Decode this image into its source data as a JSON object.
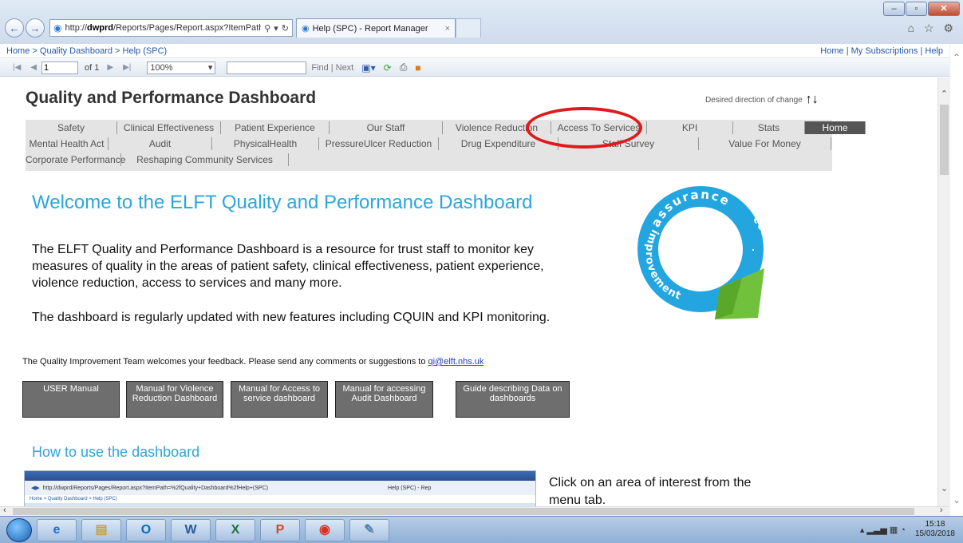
{
  "browser": {
    "url_prefix": "http://",
    "url_host": "dwprd",
    "url_rest": "/Reports/Pages/Report.aspx?ItemPath=%",
    "tab_title": "Help (SPC) - Report Manager",
    "tab_close": "×",
    "window_minimize": "–",
    "window_maximize": "▫",
    "window_close": "✕",
    "icons": "⌂ ☆ ⚙"
  },
  "breadcrumb": {
    "home": "Home",
    "dashboard": "Quality Dashboard",
    "current": "Help (SPC)",
    "separator": " > "
  },
  "toplinks": {
    "home": "Home",
    "subscriptions": "My Subscriptions",
    "help": "Help",
    "separator": " | "
  },
  "toolbar": {
    "page_value": "1",
    "page_of": "of 1",
    "zoom": "100%",
    "find": "Find",
    "next": "Next",
    "find_sep": "|"
  },
  "report": {
    "title": "Quality and Performance Dashboard",
    "direction_label": "Desired direction of change",
    "direction_arrows": "↑↓",
    "menu_row1": [
      "Safety",
      "Clinical Effectiveness",
      "Patient Experience",
      "Our Staff",
      "Violence Reduction",
      "Access To Services",
      "KPI",
      "Stats",
      "Home"
    ],
    "menu_row2": [
      "Mental Health Act",
      "Audit",
      "PhysicalHealth",
      "PressureUlcer Reduction",
      "Drug Expenditure",
      "Staff Survey",
      "Value For Money"
    ],
    "menu_row3": [
      "Corporate Performance",
      "Reshaping Community Services"
    ],
    "welcome": "Welcome to the ELFT Quality and Performance Dashboard",
    "para1_line1": "The ELFT Quality and Performance Dashboard is a resource for trust staff to monitor key",
    "para1_line2": "measures of quality in the areas of patient safety, clinical effectiveness, patient experience,",
    "para1_line3": "violence reduction, access to services and many more.",
    "para2": "The dashboard is regularly updated with new features including CQUIN and KPI monitoring.",
    "feedback_text": "The Quality Improvement Team welcomes your feedback. Please send any comments or suggestions to ",
    "feedback_email": "qi@elft.nhs.uk",
    "buttons": [
      "USER Manual",
      "Manual for Violence Reduction Dashboard",
      "Manual for Access to service dashboard",
      "Manual for accessing Audit Dashboard",
      "Guide describing Data on dashboards"
    ],
    "howto": "How to use the dashboard",
    "click_line1": "Click on an area of interest from the",
    "click_line2": "menu tab.",
    "logo_words": [
      "assurance",
      "control",
      "improvement"
    ],
    "mini_url": "http://dwprd/Reports/Pages/Report.aspx?ItemPath=%2fQuality+Dashboard%2fHelp+(SPC)",
    "mini_tab": "Help (SPC) - Rep",
    "mini_crumb": "Home > Quality Dashboard > Help (SPC)"
  },
  "taskbar": {
    "time": "15:18",
    "date": "15/03/2018"
  }
}
